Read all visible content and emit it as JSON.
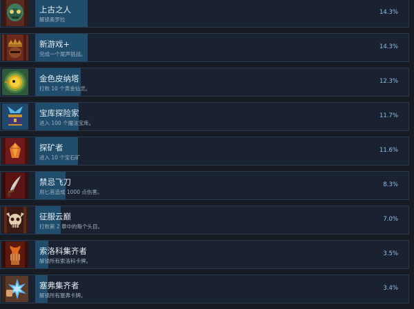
{
  "achievements": [
    {
      "name": "上古之人",
      "desc": "解锁奥罗拉",
      "percent": "14.3%",
      "fill": 0.143,
      "icon": "ancient-robot-icon"
    },
    {
      "name": "新游戏+",
      "desc": "完成一个尾声挑战。",
      "percent": "14.3%",
      "fill": 0.143,
      "icon": "crown-knight-icon"
    },
    {
      "name": "金色皮纳塔",
      "desc": "打败 10 个黄金仙灵。",
      "percent": "12.3%",
      "fill": 0.123,
      "icon": "golden-pinata-icon"
    },
    {
      "name": "宝库探险家",
      "desc": "进入 100 个魔法宝库。",
      "percent": "11.7%",
      "fill": 0.117,
      "icon": "treasure-chest-icon"
    },
    {
      "name": "探矿者",
      "desc": "进入 10 个宝石矿",
      "percent": "11.6%",
      "fill": 0.116,
      "icon": "gem-ore-icon"
    },
    {
      "name": "禁忌飞刀",
      "desc": "用匕首造成 1000 点伤害。",
      "percent": "8.3%",
      "fill": 0.083,
      "icon": "dagger-icon"
    },
    {
      "name": "征服云巅",
      "desc": "打败第 2 章中的每个头目。",
      "percent": "7.0%",
      "fill": 0.07,
      "icon": "horned-skull-icon"
    },
    {
      "name": "索洛科集齐者",
      "desc": "解锁所有索洛科卡牌。",
      "percent": "3.5%",
      "fill": 0.035,
      "icon": "fire-fist-icon"
    },
    {
      "name": "塞弗集齐者",
      "desc": "解锁所有塞弗卡牌。",
      "percent": "3.4%",
      "fill": 0.034,
      "icon": "ice-burst-icon"
    }
  ]
}
